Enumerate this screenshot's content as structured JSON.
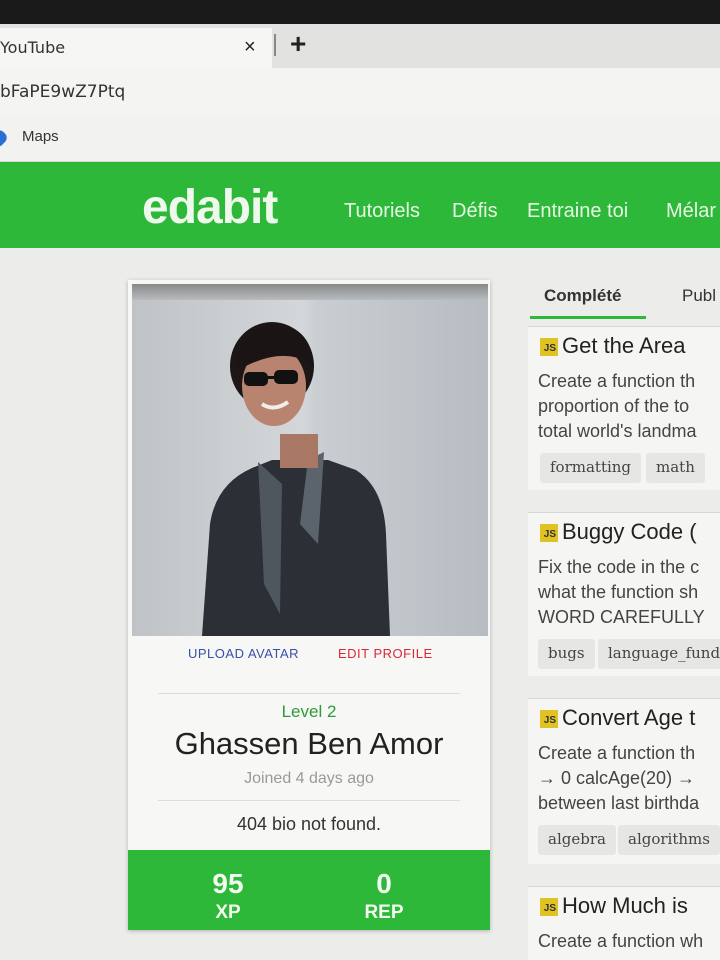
{
  "browser": {
    "tab_title": "YouTube",
    "tab_close": "×",
    "new_tab": "+",
    "url": "bFaPE9wZ7Ptq",
    "bookmarks": [
      {
        "label": "Maps"
      }
    ]
  },
  "site": {
    "logo": "edabit",
    "nav": [
      "Tutoriels",
      "Défis",
      "Entraine toi",
      "Mélar"
    ]
  },
  "profile": {
    "upload_avatar": "UPLOAD AVATAR",
    "edit_profile": "EDIT PROFILE",
    "level": "Level 2",
    "name": "Ghassen Ben Amor",
    "joined": "Joined 4 days ago",
    "bio": "404 bio not found.",
    "stats": [
      {
        "value": "95",
        "label": "XP"
      },
      {
        "value": "0",
        "label": "REP"
      }
    ]
  },
  "tabs": {
    "completed": "Complété",
    "published": "Publ"
  },
  "challenges": [
    {
      "lang": "JS",
      "title": "Get the Area",
      "desc": [
        "Create a function th",
        "proportion of the to",
        "total world's landma"
      ],
      "tags": [
        "formatting",
        "math"
      ]
    },
    {
      "lang": "JS",
      "title": "Buggy Code (",
      "desc": [
        "Fix the code in the c",
        "what the function sh",
        "WORD CAREFULLY"
      ],
      "tags": [
        "bugs",
        "language_funda"
      ]
    },
    {
      "lang": "JS",
      "title": "Convert Age t",
      "desc": [
        "Create a function th",
        "→ 0 calcAge(20) → ",
        "between last birthda"
      ],
      "tags": [
        "algebra",
        "algorithms"
      ]
    },
    {
      "lang": "JS",
      "title": "How Much is",
      "desc": [
        "Create a function wh"
      ],
      "tags": []
    }
  ]
}
